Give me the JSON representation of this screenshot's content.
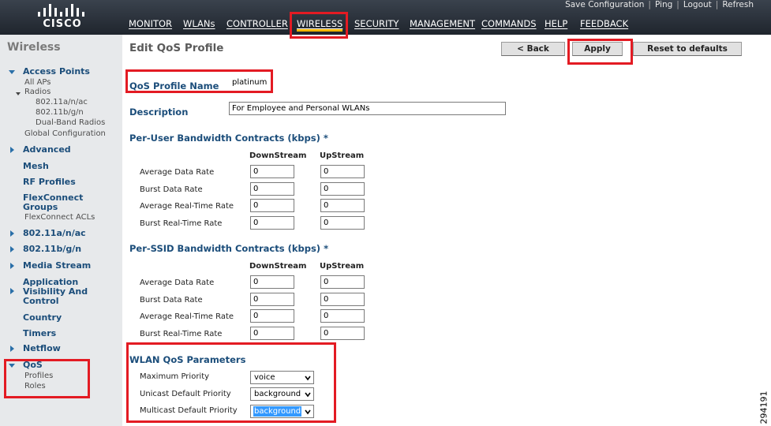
{
  "header": {
    "brand": "CISCO",
    "utility_links": [
      "Save Configuration",
      "Ping",
      "Logout",
      "Refresh"
    ],
    "nav_items": [
      "MONITOR",
      "WLANs",
      "CONTROLLER",
      "WIRELESS",
      "SECURITY",
      "MANAGEMENT",
      "COMMANDS",
      "HELP",
      "FEEDBACK"
    ],
    "active_nav": "WIRELESS",
    "active_underline_color": "#f0b400"
  },
  "sidebar": {
    "title": "Wireless",
    "access_points": "Access Points",
    "all_aps": "All APs",
    "radios": "Radios",
    "radio_a": "802.11a/n/ac",
    "radio_b": "802.11b/g/n",
    "dual_band": "Dual-Band Radios",
    "global_config": "Global Configuration",
    "advanced": "Advanced",
    "mesh": "Mesh",
    "rf_profiles": "RF Profiles",
    "flexconnect_groups_1": "FlexConnect",
    "flexconnect_groups_2": "Groups",
    "flexconnect_acls": "FlexConnect ACLs",
    "band_a": "802.11a/n/ac",
    "band_b": "802.11b/g/n",
    "media_stream": "Media Stream",
    "avc_1": "Application",
    "avc_2": "Visibility And",
    "avc_3": "Control",
    "country": "Country",
    "timers": "Timers",
    "netflow": "Netflow",
    "qos": "QoS",
    "profiles": "Profiles",
    "roles": "Roles"
  },
  "page": {
    "title": "Edit QoS Profile",
    "back_button": "< Back",
    "apply_button": "Apply",
    "reset_button": "Reset to defaults",
    "profile_name_label": "QoS Profile Name",
    "profile_name_value": "platinum",
    "description_label": "Description",
    "description_value": "For Employee and Personal WLANs"
  },
  "per_user": {
    "heading": "Per-User Bandwidth Contracts (kbps) *",
    "col_down": "DownStream",
    "col_up": "UpStream",
    "rows": [
      {
        "label": "Average Data Rate",
        "down": "0",
        "up": "0"
      },
      {
        "label": "Burst Data Rate",
        "down": "0",
        "up": "0"
      },
      {
        "label": "Average Real-Time Rate",
        "down": "0",
        "up": "0"
      },
      {
        "label": "Burst Real-Time Rate",
        "down": "0",
        "up": "0"
      }
    ]
  },
  "per_ssid": {
    "heading": "Per-SSID Bandwidth Contracts (kbps) *",
    "col_down": "DownStream",
    "col_up": "UpStream",
    "rows": [
      {
        "label": "Average Data Rate",
        "down": "0",
        "up": "0"
      },
      {
        "label": "Burst Data Rate",
        "down": "0",
        "up": "0"
      },
      {
        "label": "Average Real-Time Rate",
        "down": "0",
        "up": "0"
      },
      {
        "label": "Burst Real-Time Rate",
        "down": "0",
        "up": "0"
      }
    ]
  },
  "wlan_qos": {
    "heading": "WLAN QoS Parameters",
    "max_priority_label": "Maximum Priority",
    "max_priority_value": "voice",
    "unicast_label": "Unicast Default Priority",
    "unicast_value": "background",
    "multicast_label": "Multicast Default Priority",
    "multicast_value": "background"
  },
  "figure_number": "294191",
  "colors": {
    "highlight_box": "#e31b23",
    "link_blue": "#1b4d7a",
    "header_bg": "#29303a",
    "sidebar_bg": "#e7e9eb"
  }
}
